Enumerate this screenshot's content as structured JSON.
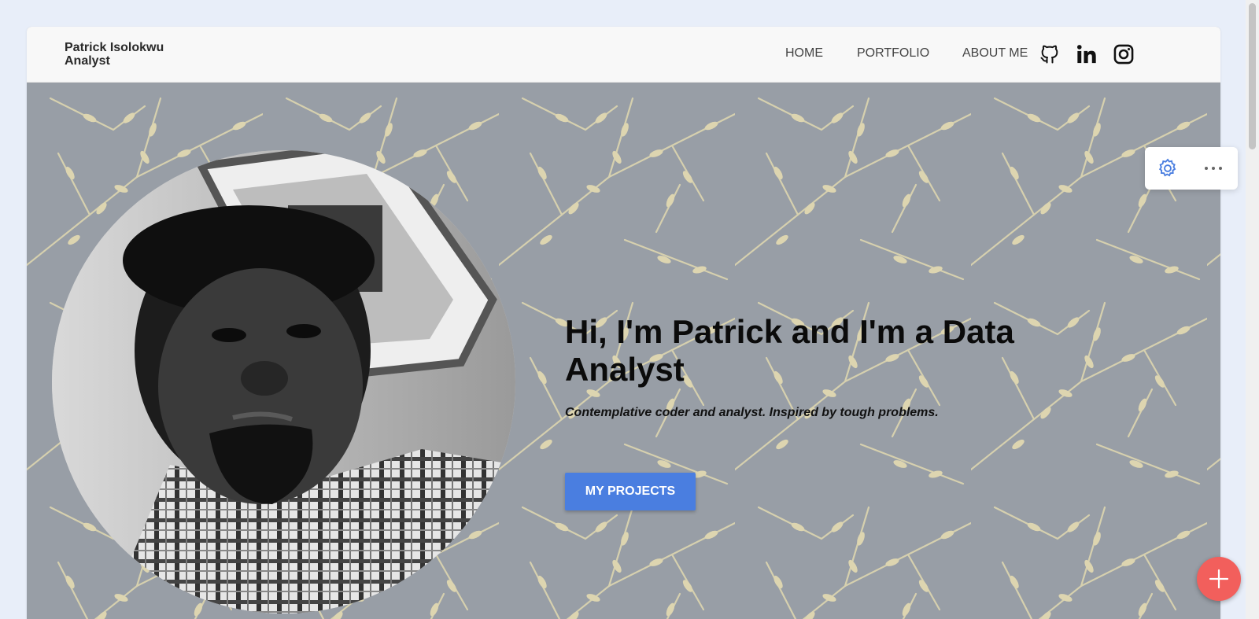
{
  "navbar": {
    "brand_line1": "Patrick Isolokwu",
    "brand_line2": "Analyst",
    "links": [
      {
        "label": "HOME"
      },
      {
        "label": "PORTFOLIO"
      },
      {
        "label": "ABOUT ME"
      }
    ],
    "social_icons": [
      "github-icon",
      "linkedin-icon",
      "instagram-icon"
    ]
  },
  "hero": {
    "title": "Hi, I'm Patrick and I'm a Data Analyst",
    "subtitle": "Contemplative coder and analyst. Inspired by tough problems.",
    "cta_label": "MY PROJECTS",
    "background_color": "#989ea6",
    "branch_color": "#d8d2b0"
  },
  "editor": {
    "settings_icon": "gear-icon",
    "more_icon": "more-dots-icon",
    "add_icon": "plus-icon"
  },
  "colors": {
    "accent": "#4a7ee0",
    "fab": "#f25f5c",
    "page_bg": "#e8eef9"
  }
}
